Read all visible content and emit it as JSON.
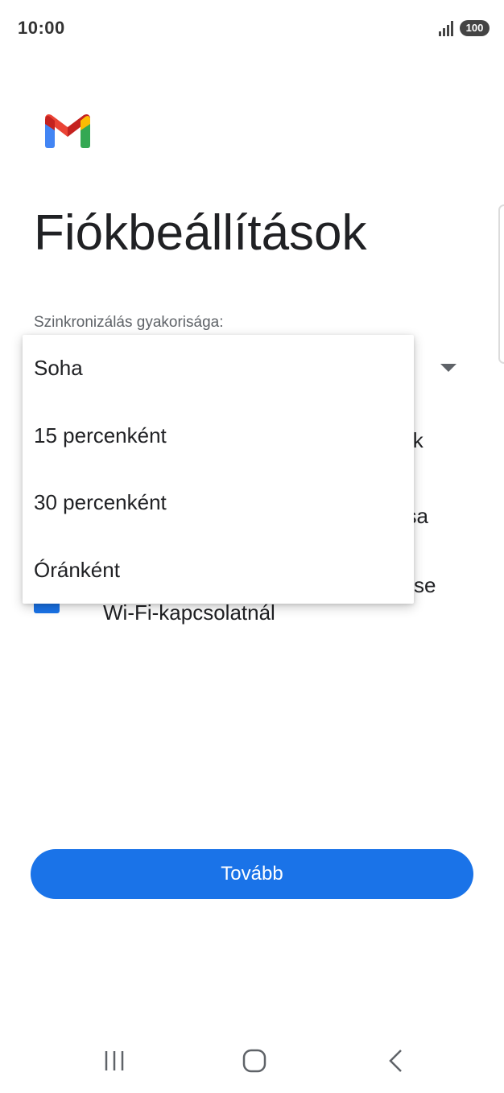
{
  "status_bar": {
    "time": "10:00",
    "battery": "100",
    "signal_icon": "cellular-signal-icon"
  },
  "app": {
    "logo_icon": "gmail-logo-icon",
    "colors": {
      "accent": "#1a73e8",
      "gmail_red": "#ea4335",
      "gmail_blue": "#4285f4",
      "gmail_green": "#34a853",
      "gmail_yellow": "#fbbc04"
    }
  },
  "page": {
    "title": "Fiókbeállítások",
    "sync_label": "Szinkronizálás gyakorisága:"
  },
  "background_fragments": {
    "line_1": "zik",
    "line_2": "ása",
    "line_3": "se",
    "line_4": "Wi-Fi-kapcsolatnál"
  },
  "dropdown": {
    "options": [
      "Soha",
      "15 percenként",
      "30 percenként",
      "Óránként"
    ]
  },
  "footer": {
    "continue_label": "Tovább"
  },
  "nav_bar": {
    "recent_icon": "recent-apps-icon",
    "home_icon": "home-icon",
    "back_icon": "back-icon"
  }
}
